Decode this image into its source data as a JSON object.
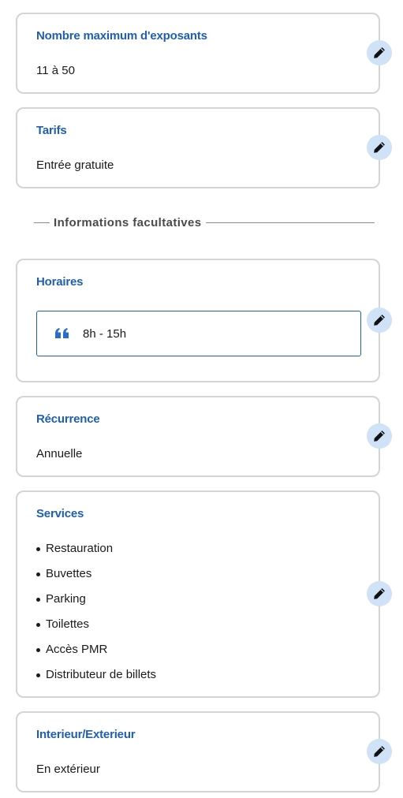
{
  "cards": {
    "exhibitors": {
      "title": "Nombre maximum d'exposants",
      "value": "11 à 50"
    },
    "pricing": {
      "title": "Tarifs",
      "value": "Entrée gratuite"
    },
    "hours": {
      "title": "Horaires",
      "value": "8h - 15h"
    },
    "recurrence": {
      "title": "Récurrence",
      "value": "Annuelle"
    },
    "services": {
      "title": "Services",
      "items": [
        "Restauration",
        "Buvettes",
        "Parking",
        "Toilettes",
        "Accès PMR",
        "Distributeur de billets"
      ]
    },
    "location": {
      "title": "Interieur/Exterieur",
      "value": "En extérieur"
    }
  },
  "divider": {
    "label": "Informations facultatives"
  },
  "icons": {
    "edit": "pencil-icon",
    "quote": "quote-icon"
  },
  "colors": {
    "title": "#1f5fad",
    "edit_bg": "#d0e2f8",
    "border": "#d4d4d4"
  }
}
